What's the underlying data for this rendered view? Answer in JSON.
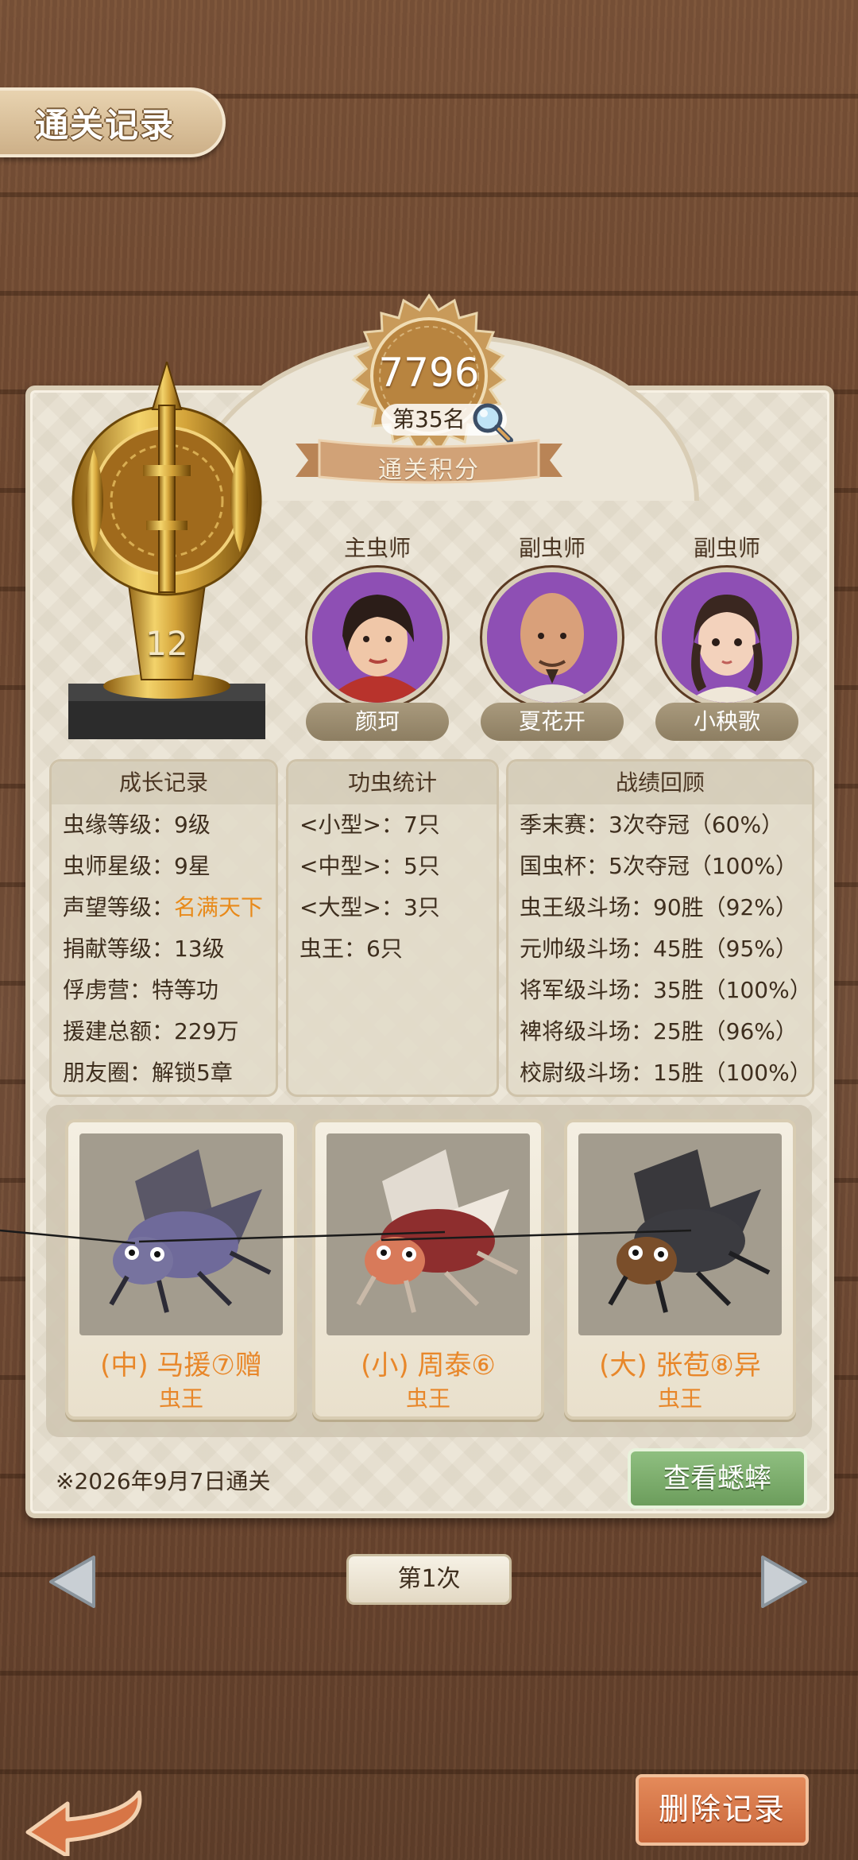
{
  "header": {
    "title": "通关记录"
  },
  "score": {
    "points": "7796",
    "rank": "第35名",
    "label": "通关积分"
  },
  "trophy": {
    "level": "12"
  },
  "masters": [
    {
      "role": "主虫师",
      "name": "颜珂"
    },
    {
      "role": "副虫师",
      "name": "夏花开"
    },
    {
      "role": "副虫师",
      "name": "小秧歌"
    }
  ],
  "growth": {
    "title": "成长记录",
    "rows": [
      {
        "label": "虫缘等级：",
        "value": "9级"
      },
      {
        "label": "虫师星级：",
        "value": "9星"
      },
      {
        "label": "声望等级：",
        "value": "名满天下"
      },
      {
        "label": "捐献等级：",
        "value": "13级"
      },
      {
        "label": "俘虏营：",
        "value": "特等功"
      },
      {
        "label": "援建总额：",
        "value": "229万"
      },
      {
        "label": "朋友圈：",
        "value": "解锁5章"
      }
    ]
  },
  "merit": {
    "title": "功虫统计",
    "rows": [
      {
        "label": "<小型>：",
        "value": "7只"
      },
      {
        "label": "<中型>：",
        "value": "5只"
      },
      {
        "label": "<大型>：",
        "value": "3只"
      },
      {
        "label": "虫王：",
        "value": "6只"
      }
    ]
  },
  "record": {
    "title": "战绩回顾",
    "rows": [
      {
        "label": "季末赛：",
        "value": "3次夺冠（60%）"
      },
      {
        "label": "国虫杯：",
        "value": "5次夺冠（100%）"
      },
      {
        "label": "虫王级斗场：",
        "value": "90胜（92%）"
      },
      {
        "label": "元帅级斗场：",
        "value": "45胜（95%）"
      },
      {
        "label": "将军级斗场：",
        "value": "35胜（100%）"
      },
      {
        "label": "裨将级斗场：",
        "value": "25胜（96%）"
      },
      {
        "label": "校尉级斗场：",
        "value": "15胜（100%）"
      }
    ]
  },
  "crickets": [
    {
      "name": "(中) 马援⑦赠",
      "title": "虫王",
      "body_color": "#6f6a9a"
    },
    {
      "name": "(小) 周泰⑥",
      "title": "虫王",
      "body_color": "#a8403a"
    },
    {
      "name": "(大) 张苞⑧异",
      "title": "虫王",
      "body_color": "#3b3b40"
    }
  ],
  "footer": {
    "date": "※2026年9月7日通关",
    "view_button": "查看蟋蟀",
    "page_label": "第1次",
    "delete_button": "删除记录"
  },
  "colors": {
    "accent_orange": "#e8872a",
    "green_button": "#7aaa6a",
    "red_button": "#d4764a"
  }
}
